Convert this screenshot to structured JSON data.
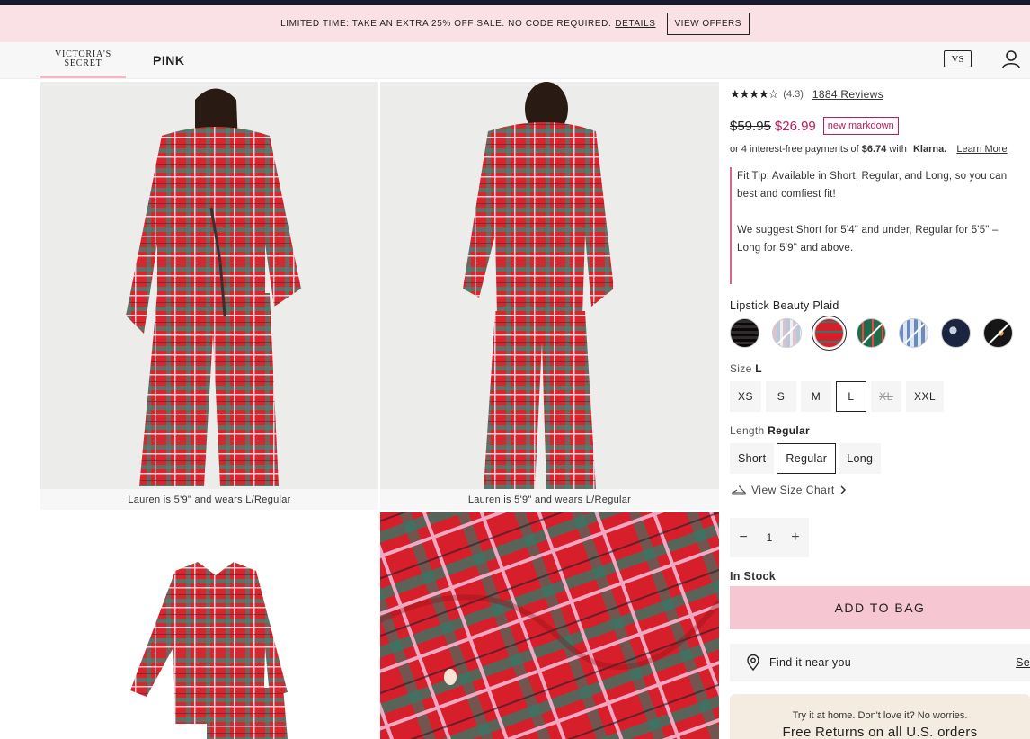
{
  "promo": {
    "text": "LIMITED TIME: TAKE AN EXTRA 25% OFF SALE. NO CODE REQUIRED.",
    "details_link": "DETAILS",
    "offers_button": "VIEW OFFERS"
  },
  "nav": {
    "brand_line1": "VICTORIA'S",
    "brand_line2": "SECRET",
    "pink": "PINK",
    "bag_glyph": "VS"
  },
  "gallery": {
    "caption1": "Lauren is 5'9\" and wears L/Regular",
    "caption2": "Lauren is 5'9\" and wears L/Regular"
  },
  "product": {
    "stars": "★★★★☆",
    "rating": "(4.3)",
    "reviews": "1884 Reviews",
    "old_price": "$59.95",
    "new_price": "$26.99",
    "badge": "new markdown",
    "klarna_prefix": "or 4 interest-free payments of",
    "klarna_amount": "$6.74",
    "klarna_with": "with",
    "klarna_logo": "Klarna.",
    "klarna_learn": "Learn More",
    "fit_tip_1": "Fit Tip: Available in Short, Regular, and Long, so you can",
    "fit_tip_1b": "best and comfiest fit!",
    "fit_tip_2": "We suggest Short for 5'4\" and under, Regular for 5'5\" –",
    "fit_tip_2b": "Long for 5'9\" and above.",
    "color_name": "Lipstick Beauty Plaid",
    "size_label": "Size",
    "size_selected": "L",
    "sizes": [
      "XS",
      "S",
      "M",
      "L",
      "XL",
      "XXL"
    ],
    "length_label": "Length",
    "length_selected": "Regular",
    "lengths": [
      "Short",
      "Regular",
      "Long"
    ],
    "size_chart": "View Size Chart",
    "qty_minus": "−",
    "qty_value": "1",
    "qty_plus": "+",
    "stock": "In Stock",
    "add_to_bag": "ADD TO BAG",
    "find_near": "Find it near you",
    "find_see": "Se",
    "returns_small": "Try it at home. Don't love it? No worries.",
    "returns_big": "Free Returns on all U.S. orders"
  },
  "colors": {
    "accent_pink": "#f7c6d3",
    "markdown_red": "#c2185b",
    "promo_bg": "#f9e1e6"
  }
}
